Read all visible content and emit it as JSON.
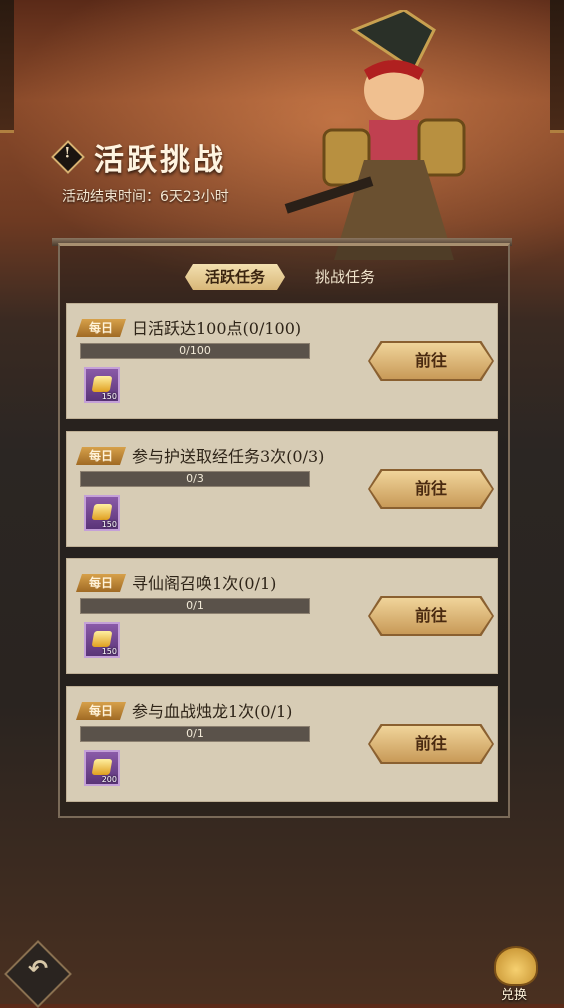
{
  "header": {
    "title": "活跃挑战",
    "title_icon_glyph": "!",
    "end_time": "活动结束时间：6天23小时"
  },
  "tabs": [
    {
      "label": "活跃任务",
      "active": true
    },
    {
      "label": "挑战任务",
      "active": false
    }
  ],
  "tasks": [
    {
      "badge": "每日",
      "title": "日活跃达100点(0/100)",
      "progress_text": "0/100",
      "progress": 0,
      "reward_icon": "gold-ingot-icon",
      "reward_qty": "150",
      "button": "前往"
    },
    {
      "badge": "每日",
      "title": "参与护送取经任务3次(0/3)",
      "progress_text": "0/3",
      "progress": 0,
      "reward_icon": "gold-ingot-icon",
      "reward_qty": "150",
      "button": "前往"
    },
    {
      "badge": "每日",
      "title": "寻仙阁召唤1次(0/1)",
      "progress_text": "0/1",
      "progress": 0,
      "reward_icon": "gold-ingot-icon",
      "reward_qty": "150",
      "button": "前往"
    },
    {
      "badge": "每日",
      "title": "参与血战烛龙1次(0/1)",
      "progress_text": "0/1",
      "progress": 0,
      "reward_icon": "gold-ingot-icon",
      "reward_qty": "200",
      "button": "前往"
    }
  ],
  "footer": {
    "back_icon": "back-arrow-icon",
    "exchange_label": "兑换",
    "exchange_icon": "treasure-bag-icon"
  },
  "colors": {
    "accent_gold": "#d9b778",
    "card_bg": "#d7ccb5",
    "reward_purple": "#6a3c88"
  }
}
